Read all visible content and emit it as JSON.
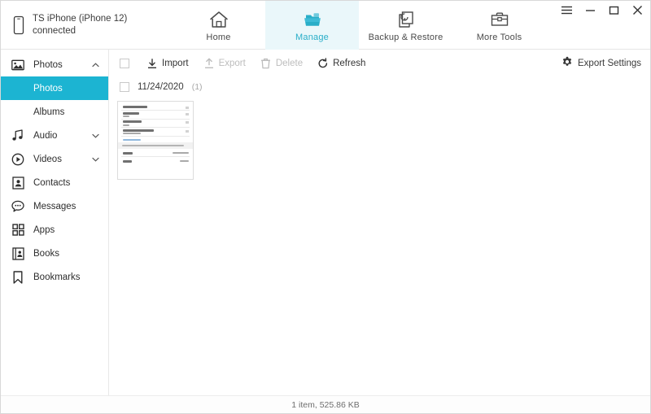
{
  "header": {
    "device": {
      "name": "TS iPhone (iPhone 12)",
      "status": "connected",
      "icon": "phone-icon"
    },
    "tabs": [
      {
        "id": "home",
        "label": "Home",
        "icon": "house-icon",
        "active": false
      },
      {
        "id": "manage",
        "label": "Manage",
        "icon": "folder-stack-icon",
        "active": true
      },
      {
        "id": "backup",
        "label": "Backup & Restore",
        "icon": "backup-restore-icon",
        "active": false
      },
      {
        "id": "tools",
        "label": "More Tools",
        "icon": "toolbox-icon",
        "active": false
      }
    ],
    "window_controls": [
      {
        "id": "menu",
        "icon": "hamburger-icon"
      },
      {
        "id": "minimize",
        "icon": "minimize-icon"
      },
      {
        "id": "maximize",
        "icon": "maximize-icon"
      },
      {
        "id": "close",
        "icon": "close-icon"
      }
    ]
  },
  "sidebar": {
    "items": [
      {
        "id": "photos",
        "label": "Photos",
        "icon": "image-icon",
        "expandable": true,
        "expanded": true
      },
      {
        "id": "audio",
        "label": "Audio",
        "icon": "music-icon",
        "expandable": true,
        "expanded": false
      },
      {
        "id": "videos",
        "label": "Videos",
        "icon": "play-icon",
        "expandable": true,
        "expanded": false
      },
      {
        "id": "contacts",
        "label": "Contacts",
        "icon": "contact-icon",
        "expandable": false,
        "expanded": false
      },
      {
        "id": "messages",
        "label": "Messages",
        "icon": "chat-icon",
        "expandable": false,
        "expanded": false
      },
      {
        "id": "apps",
        "label": "Apps",
        "icon": "grid-icon",
        "expandable": false,
        "expanded": false
      },
      {
        "id": "books",
        "label": "Books",
        "icon": "book-icon",
        "expandable": false,
        "expanded": false
      },
      {
        "id": "bookmarks",
        "label": "Bookmarks",
        "icon": "bookmark-icon",
        "expandable": false,
        "expanded": false
      }
    ],
    "photos_children": [
      {
        "id": "photos-all",
        "label": "Photos",
        "selected": true
      },
      {
        "id": "albums",
        "label": "Albums",
        "selected": false
      }
    ],
    "selected_color": "#1cb4d2"
  },
  "toolbar": {
    "select_all_checked": false,
    "buttons": [
      {
        "id": "import",
        "label": "Import",
        "icon": "download-arrow-icon",
        "disabled": false
      },
      {
        "id": "export",
        "label": "Export",
        "icon": "upload-arrow-icon",
        "disabled": true
      },
      {
        "id": "delete",
        "label": "Delete",
        "icon": "trash-icon",
        "disabled": true
      },
      {
        "id": "refresh",
        "label": "Refresh",
        "icon": "refresh-icon",
        "disabled": false
      }
    ],
    "export_settings": {
      "label": "Export Settings",
      "icon": "gear-icon"
    }
  },
  "content": {
    "group": {
      "date": "11/24/2020",
      "count": "(1)",
      "checked": false
    },
    "thumbnails": [
      {
        "id": "photo-1",
        "alt": "Screenshot of a language settings list",
        "mini": {
          "rows": [
            {
              "title_w": 30,
              "sub_w": 0,
              "type": "item"
            },
            {
              "title_w": 20,
              "sub_w": 8,
              "type": "item"
            },
            {
              "title_w": 23,
              "sub_w": 8,
              "type": "item"
            },
            {
              "title_w": 38,
              "sub_w": 22,
              "type": "item"
            }
          ],
          "footer_rows": [
            {
              "title_w": 12,
              "value_w": 20
            },
            {
              "title_w": 11,
              "value_w": 11
            }
          ]
        }
      }
    ]
  },
  "statusbar": {
    "text": "1 item, 525.86 KB"
  }
}
